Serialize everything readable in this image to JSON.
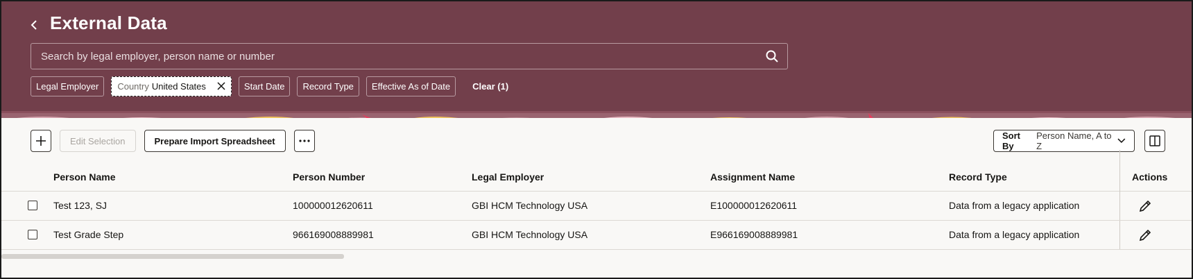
{
  "header": {
    "title": "External Data",
    "search_placeholder": "Search by legal employer, person name or number",
    "filters": [
      {
        "label": "Legal Employer"
      },
      {
        "label": "Country",
        "value": "United States",
        "active": true
      },
      {
        "label": "Start Date"
      },
      {
        "label": "Record Type"
      },
      {
        "label": "Effective As of Date"
      }
    ],
    "clear_label": "Clear (1)"
  },
  "toolbar": {
    "add_icon": "plus-icon",
    "edit_selection_label": "Edit Selection",
    "prepare_import_label": "Prepare Import Spreadsheet",
    "more_icon": "ellipsis-icon",
    "sort_label": "Sort By",
    "sort_value": "Person Name, A to Z",
    "columns_icon": "columns-icon"
  },
  "table": {
    "columns": [
      "Person Name",
      "Person Number",
      "Legal Employer",
      "Assignment Name",
      "Record Type",
      "Actions"
    ],
    "rows": [
      {
        "person_name": "Test 123, SJ",
        "person_number": "100000012620611",
        "legal_employer": "GBI HCM Technology USA",
        "assignment_name": "E100000012620611",
        "record_type": "Data from a legacy application"
      },
      {
        "person_name": "Test Grade Step",
        "person_number": "966169008889981",
        "legal_employer": "GBI HCM Technology USA",
        "assignment_name": "E966169008889981",
        "record_type": "Data from a legacy application"
      }
    ]
  },
  "colors": {
    "header_bg": "#723f4b",
    "content_bg": "#f9f8f6"
  }
}
